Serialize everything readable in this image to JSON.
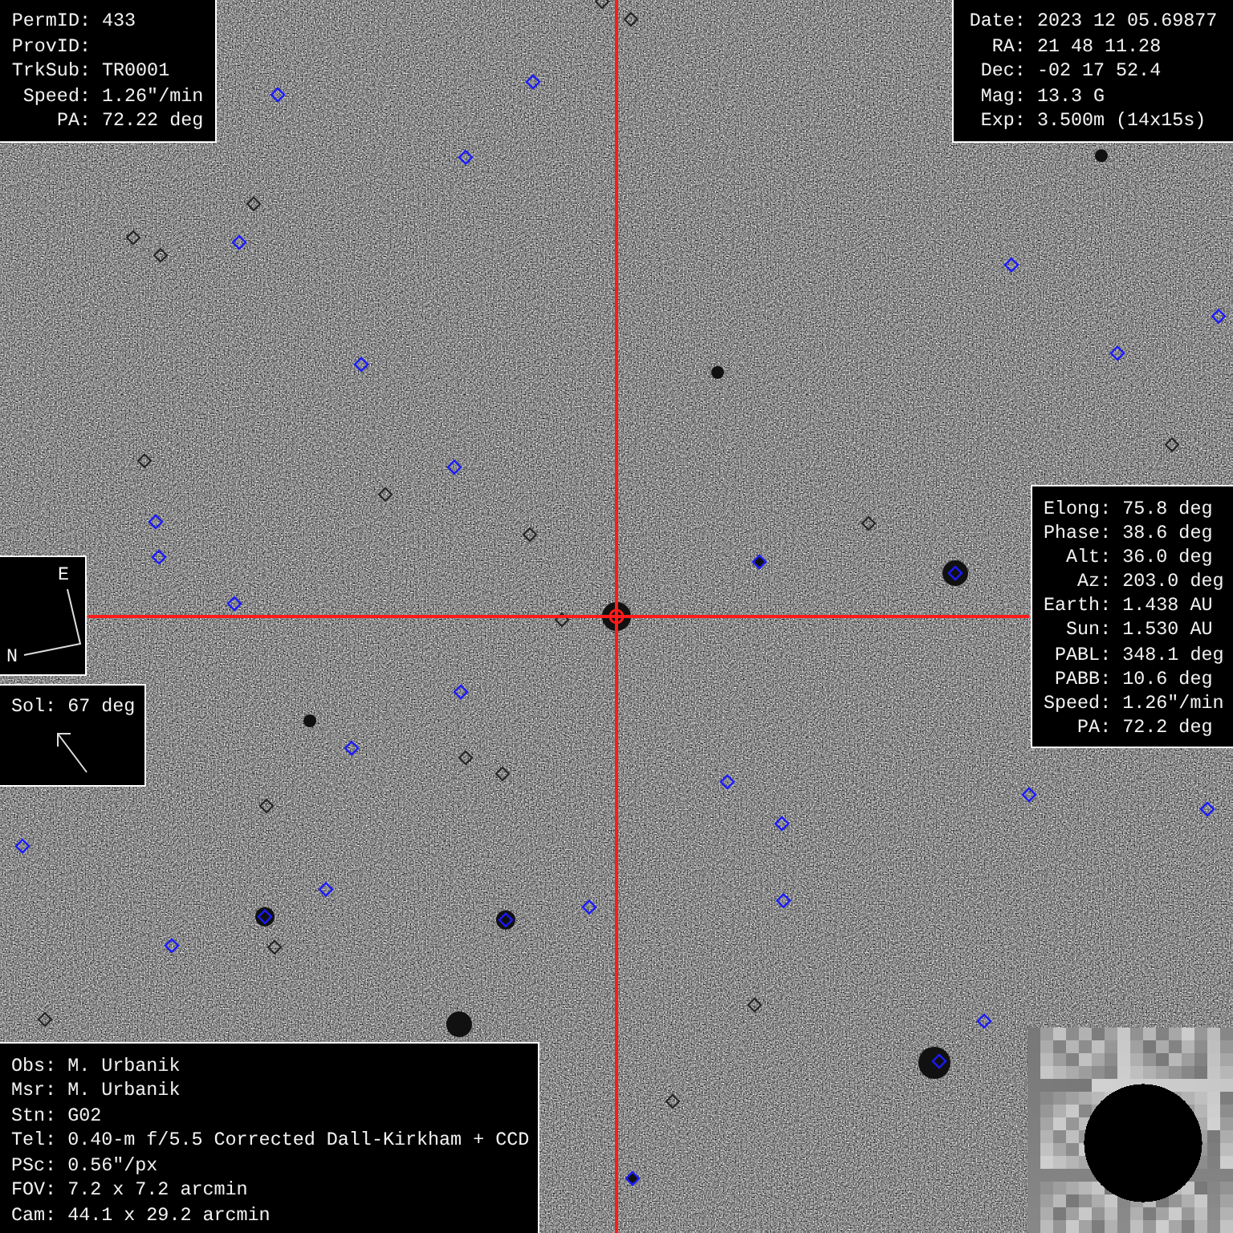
{
  "object_panel": {
    "lines": [
      {
        "label": "PermID:",
        "value": "433"
      },
      {
        "label": "ProvID:"
      },
      {
        "label": "TrkSub:",
        "value": "TR0001"
      },
      {
        "label": "Speed:",
        "value": "1.26\"/min"
      },
      {
        "label": "PA:",
        "value": "72.22 deg"
      }
    ]
  },
  "observation_panel": {
    "lines": [
      {
        "label": "Date:",
        "value": "2023 12 05.69877"
      },
      {
        "label": "RA:",
        "value": "21 48 11.28"
      },
      {
        "label": "Dec:",
        "value": "-02 17 52.4"
      },
      {
        "label": "Mag:",
        "value": "13.3 G"
      },
      {
        "label": "Exp:",
        "value": "3.500m (14x15s)"
      }
    ]
  },
  "geometry_panel": {
    "lines": [
      {
        "label": "Elong:",
        "value": "75.8 deg"
      },
      {
        "label": "Phase:",
        "value": "38.6 deg"
      },
      {
        "label": "Alt:",
        "value": "36.0 deg"
      },
      {
        "label": "Az:",
        "value": "203.0 deg"
      },
      {
        "label": "Earth:",
        "value": "1.438 AU"
      },
      {
        "label": "Sun:",
        "value": "1.530 AU"
      },
      {
        "label": "PABL:",
        "value": "348.1 deg"
      },
      {
        "label": "PABB:",
        "value": "10.6 deg"
      },
      {
        "label": "Speed:",
        "value": "1.26\"/min"
      },
      {
        "label": "PA:",
        "value": "72.2 deg"
      }
    ]
  },
  "compass": {
    "east": "E",
    "north": "N"
  },
  "sun_panel": {
    "label": "Sol:",
    "value": "67 deg"
  },
  "observer_panel": {
    "lines": [
      {
        "label": "Obs:",
        "value": "M. Urbanik"
      },
      {
        "label": "Msr:",
        "value": "M. Urbanik"
      },
      {
        "label": "Stn:",
        "value": "G02"
      },
      {
        "label": "Tel:",
        "value": "0.40-m f/5.5 Corrected Dall-Kirkham + CCD"
      },
      {
        "label": "PSc:",
        "value": "0.56\"/px"
      },
      {
        "label": "FOV:",
        "value": "7.2 x 7.2 arcmin"
      },
      {
        "label": "Cam:",
        "value": "44.1 x 29.2 arcmin"
      }
    ]
  }
}
